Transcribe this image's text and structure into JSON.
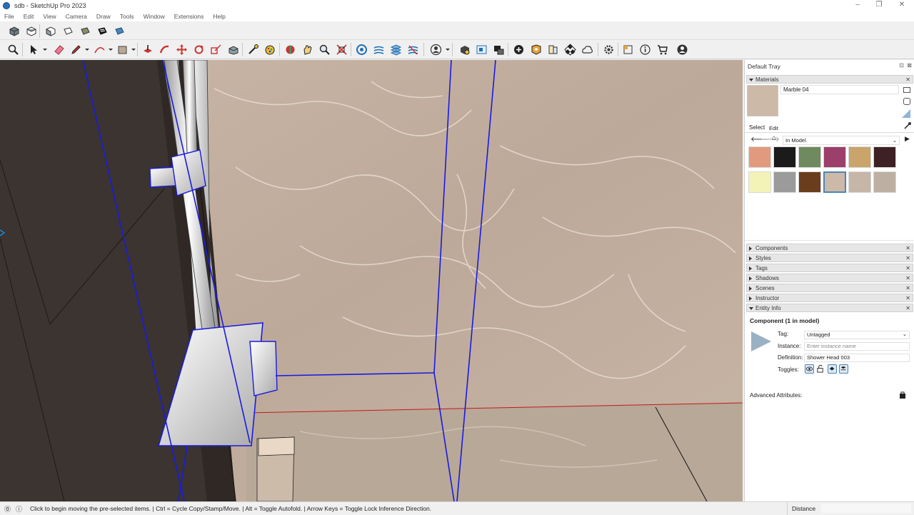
{
  "window": {
    "title": "sdb - SketchUp Pro 2023",
    "controls": [
      "–",
      "❐",
      "✕"
    ]
  },
  "menu": [
    "File",
    "Edit",
    "View",
    "Camera",
    "Draw",
    "Tools",
    "Window",
    "Extensions",
    "Help"
  ],
  "colors": {
    "accent": "#1a1ae0",
    "viewport_wall": "#3b3430",
    "marble": "#c4b3a4"
  },
  "toolbar1": {
    "icons": [
      "iso-view-icon",
      "top-view-icon",
      "front-view-icon",
      "right-view-icon",
      "back-view-icon",
      "left-view-icon",
      "bottom-view-icon"
    ]
  },
  "toolbar2": {
    "icons": [
      "zoom-icon",
      "select-icon",
      "eraser-icon",
      "pencil-icon",
      "arc-icon",
      "rectangle-icon",
      "push-pull-icon",
      "follow-me-icon",
      "move-icon",
      "rotate-icon",
      "scale-icon",
      "offset-icon",
      "tape-measure-icon",
      "paint-bucket-icon",
      "orbit-icon",
      "pan-icon",
      "zoom-tool-icon",
      "zoom-extents-icon",
      "sandbox-icon",
      "section-plane-icon",
      "section-fill-icon",
      "section-display-icon",
      "user-icon",
      "component-icon",
      "layout-icon",
      "solid-tools-icon",
      "add-location-icon",
      "warehouse-icon",
      "extension-icon",
      "cloud-icon",
      "checker-icon",
      "sketchup-cloud-icon",
      "settings-icon",
      "trimble-icon",
      "info-icon",
      "cart-icon",
      "profile-icon"
    ]
  },
  "tray": {
    "title": "Default Tray",
    "materials": {
      "header": "Materials",
      "name": "Marble 04",
      "tabs": [
        "Select",
        "Edit"
      ],
      "library": "In Model",
      "swatches": [
        "#e29a7e",
        "#1b1b1b",
        "#6e8a5e",
        "#9c3f6a",
        "#c9a56c",
        "#3e2124",
        "#f3f3b7",
        "#9b9b9b",
        "#6a3d1e",
        "#cdb9a7",
        "#c6b6a7",
        "#bdb0a3"
      ]
    },
    "panels": [
      "Components",
      "Styles",
      "Tags",
      "Shadows",
      "Scenes",
      "Instructor",
      "Entity Info"
    ],
    "entity_info": {
      "title": "Component (1 in model)",
      "tag_label": "Tag:",
      "tag_value": "Untagged",
      "instance_label": "Instance:",
      "instance_placeholder": "Enter instance name",
      "definition_label": "Definition:",
      "definition_value": "Shower Head 003",
      "toggles_label": "Toggles:",
      "advanced_label": "Advanced Attributes:"
    }
  },
  "status": {
    "message": "Click to begin moving the pre-selected items. | Ctrl = Cycle Copy/Stamp/Move. | Alt = Toggle Autofold. | Arrow Keys = Toggle Lock Inference Direction.",
    "measure_label": "Distance"
  }
}
